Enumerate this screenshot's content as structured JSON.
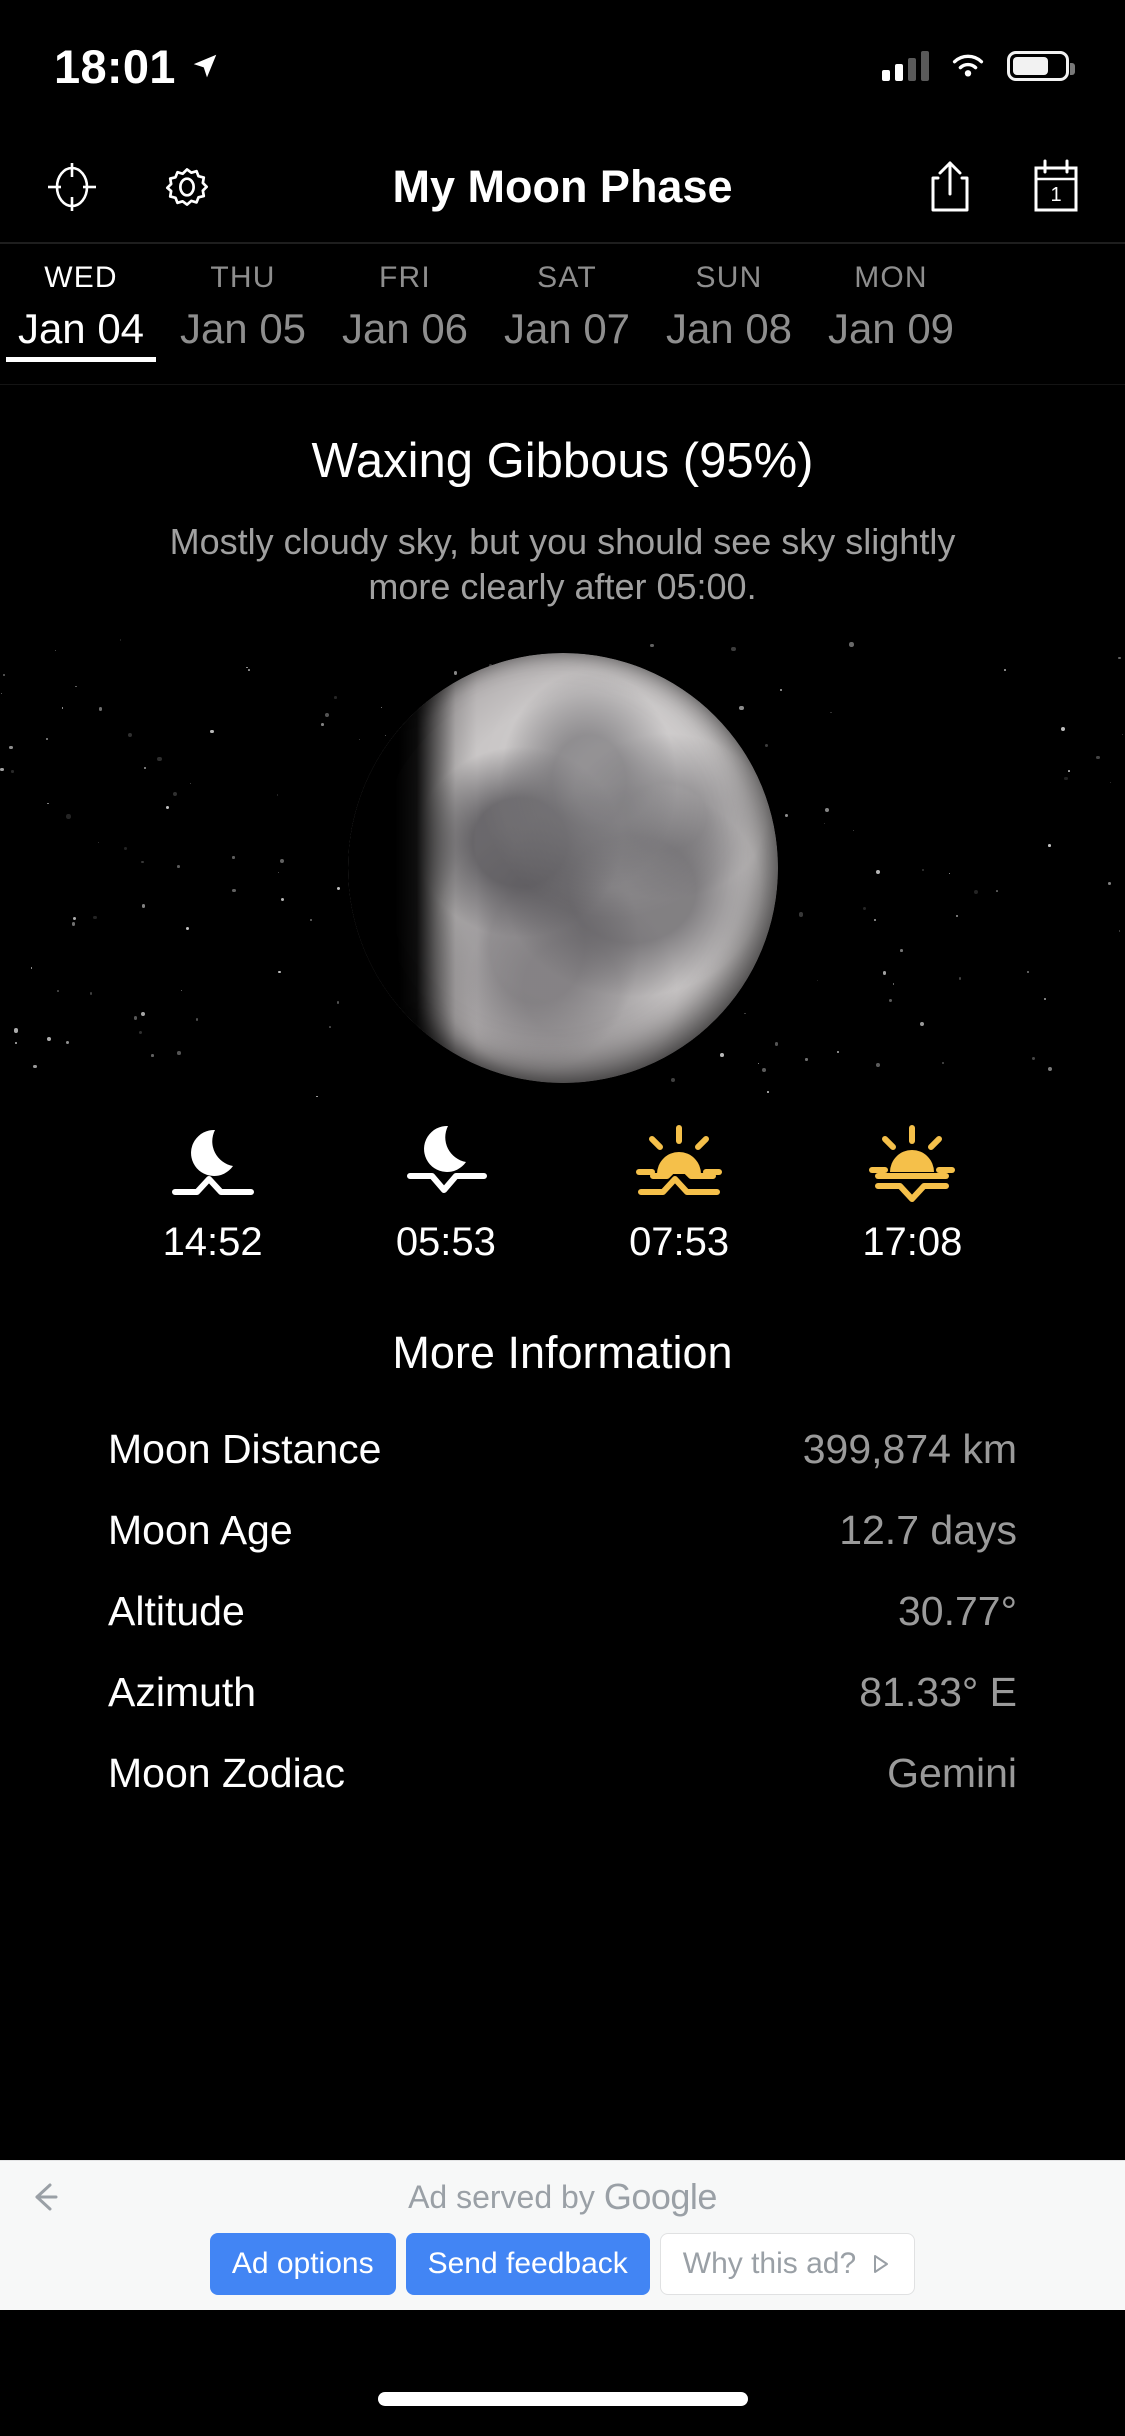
{
  "status_bar": {
    "time": "18:01",
    "location_icon": "location-arrow-icon",
    "signal_icon": "cellular-signal-icon",
    "wifi_icon": "wifi-icon",
    "battery_icon": "battery-icon"
  },
  "nav": {
    "title": "My Moon Phase",
    "locate_icon": "crosshair-location-icon",
    "settings_icon": "gear-icon",
    "share_icon": "share-icon",
    "calendar_icon": "calendar-icon",
    "calendar_day": "1"
  },
  "days": [
    {
      "dow": "WED",
      "date": "Jan 04",
      "active": true
    },
    {
      "dow": "THU",
      "date": "Jan 05",
      "active": false
    },
    {
      "dow": "FRI",
      "date": "Jan 06",
      "active": false
    },
    {
      "dow": "SAT",
      "date": "Jan 07",
      "active": false
    },
    {
      "dow": "SUN",
      "date": "Jan 08",
      "active": false
    },
    {
      "dow": "MON",
      "date": "Jan 09",
      "active": false
    }
  ],
  "phase": {
    "title": "Waxing Gibbous (95%)",
    "description": "Mostly cloudy sky, but you should see sky slightly more clearly after 05:00.",
    "illumination_percent": 95,
    "moon_image": "waxing-gibbous-moon-photo"
  },
  "riseset": [
    {
      "icon": "moonrise-icon",
      "label": "moonrise",
      "time": "14:52",
      "color": "#ffffff"
    },
    {
      "icon": "moonset-icon",
      "label": "moonset",
      "time": "05:53",
      "color": "#ffffff"
    },
    {
      "icon": "sunrise-icon",
      "label": "sunrise",
      "time": "07:53",
      "color": "#f5c04a"
    },
    {
      "icon": "sunset-icon",
      "label": "sunset",
      "time": "17:08",
      "color": "#f5c04a"
    }
  ],
  "more_information": {
    "heading": "More Information",
    "rows": [
      {
        "label": "Moon Distance",
        "value": "399,874 km"
      },
      {
        "label": "Moon Age",
        "value": "12.7 days"
      },
      {
        "label": "Altitude",
        "value": "30.77°"
      },
      {
        "label": "Azimuth",
        "value": "81.33° E"
      },
      {
        "label": "Moon Zodiac",
        "value": "Gemini"
      }
    ]
  },
  "ad": {
    "back_icon": "back-arrow-icon",
    "served_by": "Ad served by",
    "brand": "Google",
    "options_label": "Ad options",
    "feedback_label": "Send feedback",
    "why_label": "Why this ad?",
    "why_icon": "play-triangle-icon"
  },
  "colors": {
    "background": "#000000",
    "accent_sun": "#f5c04a",
    "ad_blue": "#4285f4",
    "muted_text": "#9a9a9a"
  }
}
